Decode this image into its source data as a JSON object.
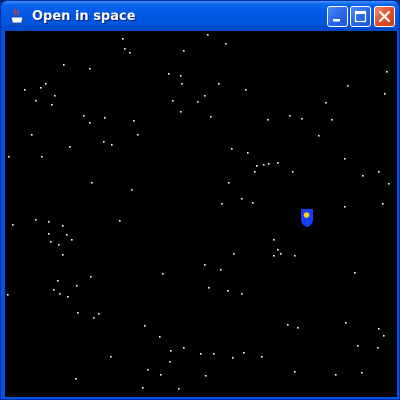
{
  "window": {
    "title": "Open in space",
    "icon": "java-coffee-cup-icon"
  },
  "controls": {
    "minimize_icon": "minimize-icon",
    "maximize_icon": "maximize-icon",
    "close_icon": "close-icon"
  },
  "scene": {
    "background_color": "#000000",
    "star_color": "#ffffff",
    "ship_color": "#1a3cff",
    "ship_light_color": "#ffd400"
  }
}
